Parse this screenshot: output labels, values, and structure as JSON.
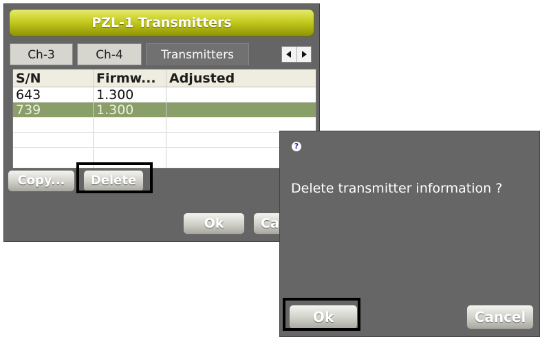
{
  "dialog": {
    "title": "PZL-1 Transmitters",
    "tabs": [
      {
        "label": "Ch-3"
      },
      {
        "label": "Ch-4"
      },
      {
        "label": "Transmitters"
      }
    ],
    "table": {
      "headers": [
        "S/N",
        "Firmw...",
        "Adjusted"
      ],
      "rows": [
        {
          "sn": "643",
          "firmware": "1.300",
          "adjusted": ""
        },
        {
          "sn": "739",
          "firmware": "1.300",
          "adjusted": "",
          "selected": true
        }
      ]
    },
    "buttons": {
      "copy": "Copy...",
      "delete": "Delete",
      "ok": "Ok",
      "cancel": "Ca"
    }
  },
  "confirm": {
    "icon": "question-icon",
    "message": "Delete transmitter information ?",
    "ok": "Ok",
    "cancel": "Cancel"
  },
  "colors": {
    "title_bar": "#c5cc1e",
    "selected_row": "#8a9e6a",
    "dialog_bg": "#666666",
    "highlight": "#000000"
  }
}
